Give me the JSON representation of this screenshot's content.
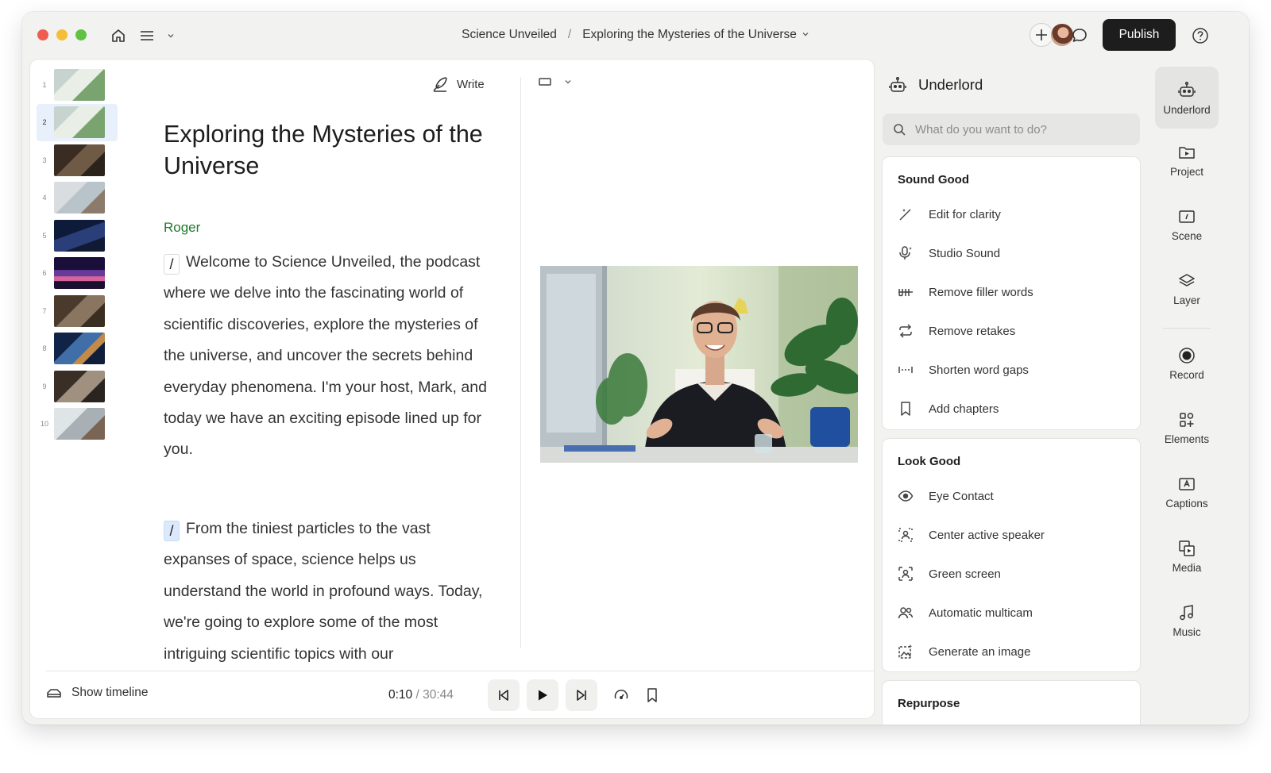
{
  "titlebar": {
    "project": "Science Unveiled",
    "separator": "/",
    "document": "Exploring the Mysteries of the Universe",
    "publish_label": "Publish"
  },
  "scenes": [
    "1",
    "2",
    "3",
    "4",
    "5",
    "6",
    "7",
    "8",
    "9",
    "10"
  ],
  "editor": {
    "write_label": "Write",
    "title": "Exploring the Mysteries of the Universe",
    "speaker": "Roger",
    "paragraph1": "Welcome to Science Unveiled, the podcast where we delve into the fascinating world of scientific discoveries, explore the mysteries of the universe, and uncover the secrets behind everyday phenomena. I'm your host, Mark, and today we have an exciting episode lined up for you.",
    "paragraph2": "From the tiniest particles to the vast expanses of space, science helps us understand the world in profound ways. Today, we're going to explore some of the most intriguing scientific topics with our",
    "slash": "/"
  },
  "playback": {
    "show_timeline": "Show timeline",
    "current": "0:10",
    "sep": " / ",
    "total": "30:44"
  },
  "underlord": {
    "title": "Underlord",
    "search_placeholder": "What do you want to do?",
    "sections": [
      {
        "title": "Sound Good",
        "items": [
          "Edit for clarity",
          "Studio Sound",
          "Remove filler words",
          "Remove retakes",
          "Shorten word gaps",
          "Add chapters"
        ]
      },
      {
        "title": "Look Good",
        "items": [
          "Eye Contact",
          "Center active speaker",
          "Green screen",
          "Automatic multicam",
          "Generate an image"
        ]
      },
      {
        "title": "Repurpose",
        "items": []
      }
    ]
  },
  "rail": [
    "Underlord",
    "Project",
    "Scene",
    "Layer",
    "Record",
    "Elements",
    "Captions",
    "Media",
    "Music"
  ],
  "colors": {
    "accent_green": "#1f7a2e",
    "publish_bg": "#1d1d1d",
    "selected_scene": "#e7f0fb"
  }
}
